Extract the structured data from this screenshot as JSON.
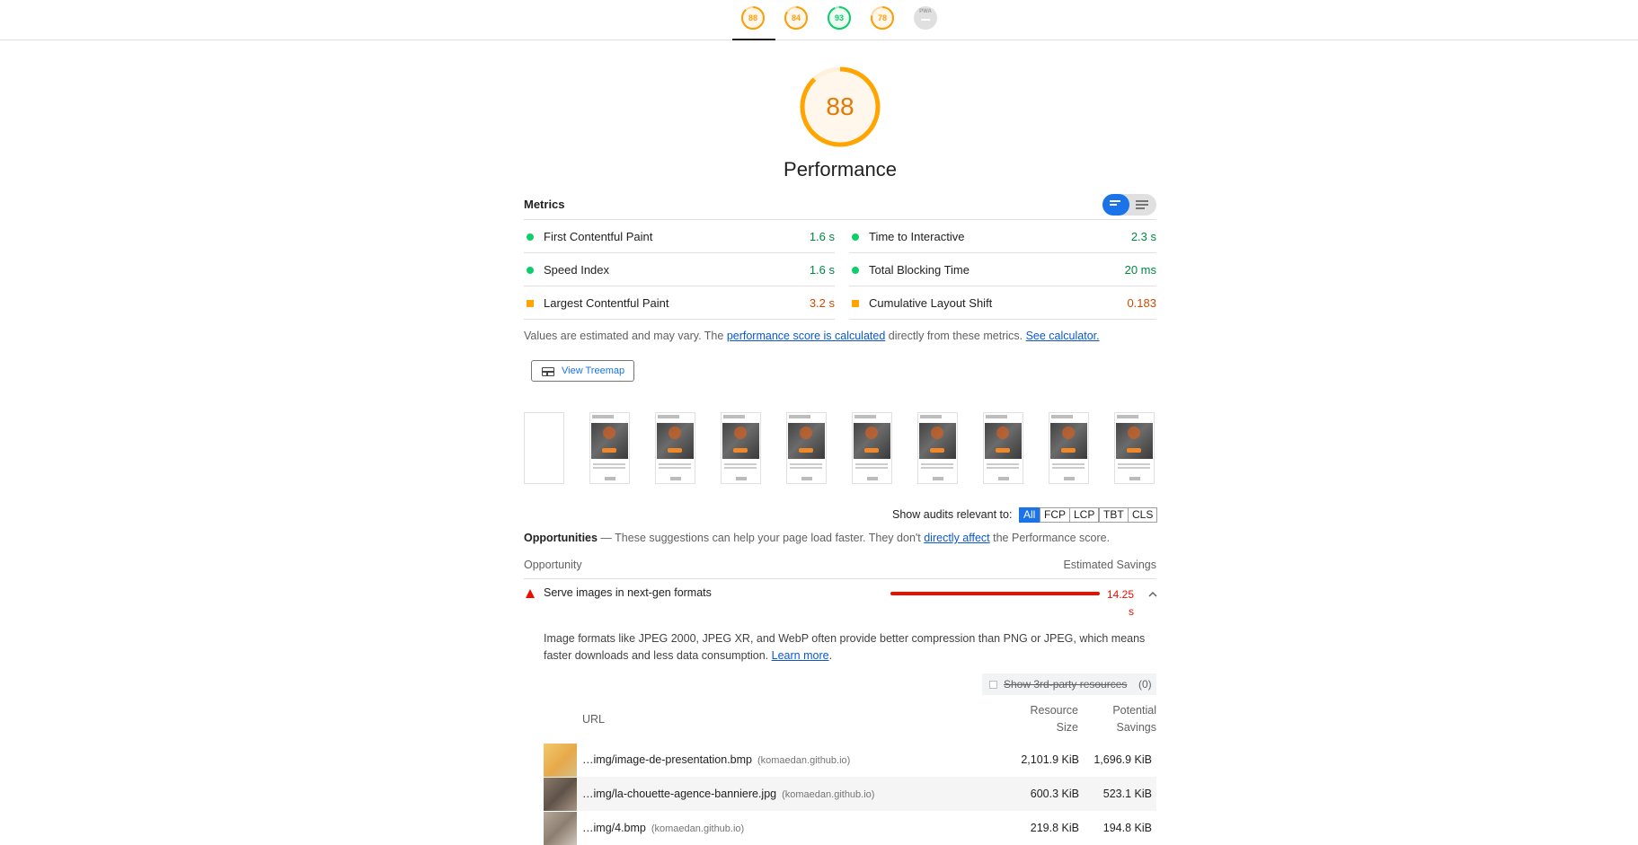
{
  "header": {
    "gauges": [
      {
        "label": "88",
        "score": 88,
        "color": "#fa9f0a"
      },
      {
        "label": "84",
        "score": 84,
        "color": "#fa9f0a"
      },
      {
        "label": "93",
        "score": 93,
        "color": "#0cce6b"
      },
      {
        "label": "78",
        "score": 78,
        "color": "#fa9f0a"
      },
      {
        "label": "PWA",
        "score": null,
        "color": "#9e9e9e"
      }
    ]
  },
  "performance": {
    "score": "88",
    "score_value": 88,
    "title": "Performance",
    "accent_color": "#ffa400"
  },
  "metrics": {
    "label": "Metrics",
    "items": [
      {
        "name": "First Contentful Paint",
        "value": "1.6 s",
        "status": "pass"
      },
      {
        "name": "Time to Interactive",
        "value": "2.3 s",
        "status": "pass"
      },
      {
        "name": "Speed Index",
        "value": "1.6 s",
        "status": "pass"
      },
      {
        "name": "Total Blocking Time",
        "value": "20 ms",
        "status": "pass"
      },
      {
        "name": "Largest Contentful Paint",
        "value": "3.2 s",
        "status": "average"
      },
      {
        "name": "Cumulative Layout Shift",
        "value": "0.183",
        "status": "average"
      }
    ],
    "note_prefix": "Values are estimated and may vary. The ",
    "note_link1": "performance score is calculated",
    "note_middle": " directly from these metrics. ",
    "note_link2": "See calculator."
  },
  "treemap_button": "View Treemap",
  "filmstrip": {
    "frames": 10
  },
  "audit_filter": {
    "label": "Show audits relevant to:",
    "options": [
      "All",
      "FCP",
      "LCP",
      "TBT",
      "CLS"
    ],
    "selected": "All"
  },
  "opportunities": {
    "title": "Opportunities",
    "desc_prefix": " — These suggestions can help your page load faster. They don't ",
    "desc_link": "directly affect",
    "desc_suffix": " the Performance score.",
    "col_opportunity": "Opportunity",
    "col_savings": "Estimated Savings",
    "audit": {
      "title": "Serve images in next-gen formats",
      "savings": "14.25 s",
      "savings_line1": "14.25",
      "savings_line2": "s",
      "description": "Image formats like JPEG 2000, JPEG XR, and WebP often provide better compression than PNG or JPEG, which means faster downloads and less data consumption. ",
      "learn_more": "Learn more",
      "third_party_label": "Show 3rd-party resources",
      "third_party_count": "(0)",
      "table_headers": {
        "url": "URL",
        "size_line1": "Resource",
        "size_line2": "Size",
        "savings_line1": "Potential",
        "savings_line2": "Savings"
      },
      "rows": [
        {
          "url": "…img/image-de-presentation.bmp",
          "host": "(komaedan.github.io)",
          "size": "2,101.9 KiB",
          "savings": "1,696.9 KiB"
        },
        {
          "url": "…img/la-chouette-agence-banniere.jpg",
          "host": "(komaedan.github.io)",
          "size": "600.3 KiB",
          "savings": "523.1 KiB"
        },
        {
          "url": "…img/4.bmp",
          "host": "(komaedan.github.io)",
          "size": "219.8 KiB",
          "savings": "194.8 KiB"
        }
      ]
    }
  }
}
